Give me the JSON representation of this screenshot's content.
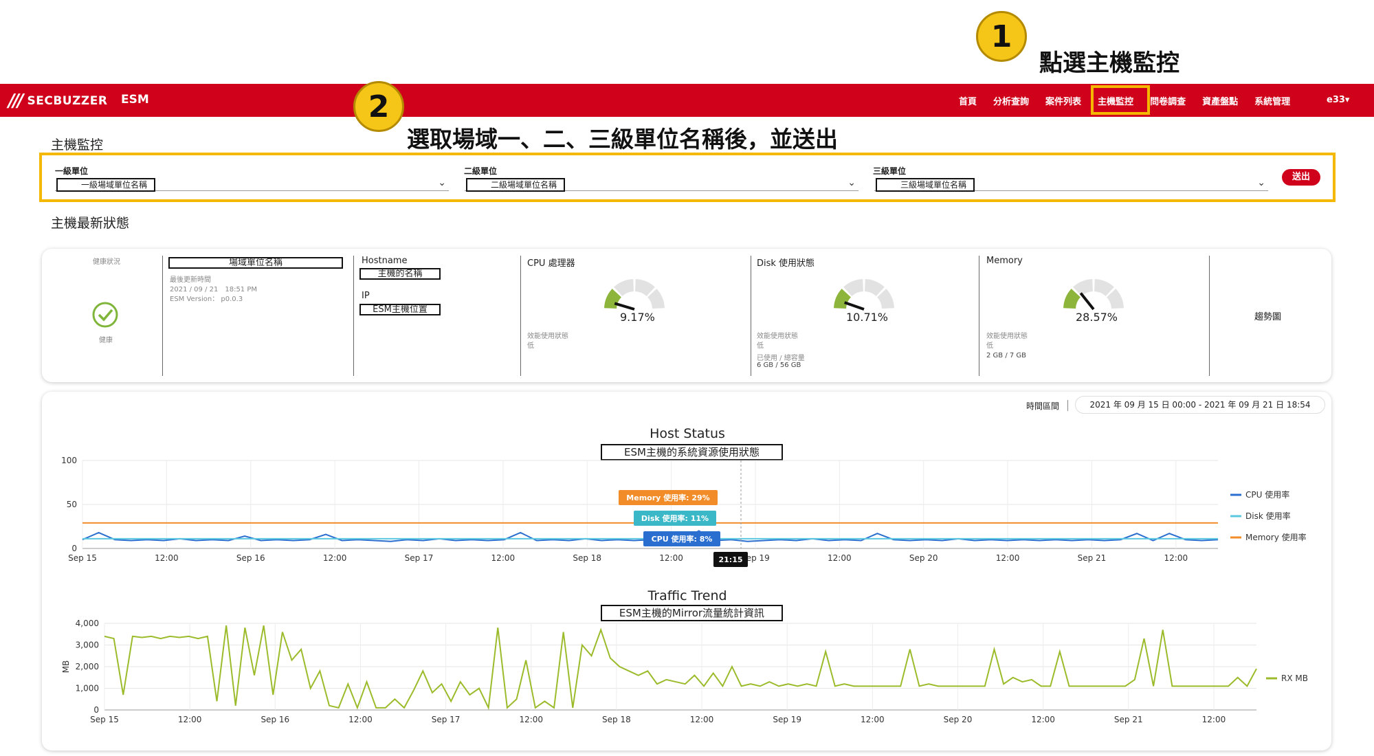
{
  "annotations": {
    "step1": {
      "number": "1",
      "text": "點選主機監控"
    },
    "step2": {
      "number": "2",
      "text": "選取場域一、二、三級單位名稱後，並送出"
    }
  },
  "navbar": {
    "logo_mark": "///",
    "logo_text": "SECBUZZER",
    "app_name": "ESM",
    "items": [
      "首頁",
      "分析查詢",
      "案件列表",
      "主機監控",
      "問卷調查",
      "資產盤點",
      "系統管理"
    ],
    "active_item": "主機監控",
    "user": "e33▾",
    "colors": {
      "brand": "#d0021b",
      "highlight": "#f5b800"
    }
  },
  "page": {
    "title": "主機監控",
    "filters": [
      {
        "label": "一級單位",
        "value": "一級場域單位名稱"
      },
      {
        "label": "二級單位",
        "value": "二級場域單位名稱"
      },
      {
        "label": "三級單位",
        "value": "三級場域單位名稱"
      }
    ],
    "submit_label": "送出",
    "status_title": "主機最新狀態"
  },
  "status_card": {
    "health_label": "健康狀況",
    "health_value": "健康",
    "unit_name": "場域單位名稱",
    "last_update_label": "最後更新時間",
    "last_update_value": "2021 / 09 / 21　18:51 PM",
    "esm_version": "ESM Version： p0.0.3",
    "hostname_label": "Hostname",
    "hostname_value": "主機的名稱",
    "ip_label": "IP",
    "ip_value": "ESM主機位置",
    "cpu": {
      "title": "CPU 處理器",
      "value": "9.17%",
      "level": 0.0917,
      "perf_label": "效能使用狀態",
      "perf_value": "低"
    },
    "disk": {
      "title": "Disk 使用狀態",
      "value": "10.71%",
      "level": 0.1071,
      "perf_label": "效能使用狀態",
      "perf_value": "低",
      "used_label": "已使用 / 總容量",
      "used_value": "6 GB / 56 GB"
    },
    "memory": {
      "title": "Memory",
      "value": "28.57%",
      "level": 0.2857,
      "perf_label": "效能使用狀態",
      "perf_value": "低",
      "used_value": "2 GB / 7 GB"
    },
    "trend_label": "趨勢圖"
  },
  "charts_card": {
    "time_range_label": "時間區間",
    "time_range_value": "2021 年 09 月 15 日 00:00 - 2021 年 09 月 21 日 18:54"
  },
  "chart_data": [
    {
      "type": "line",
      "title": "Host Status",
      "subtitle": "ESM主機的系統資源使用狀態",
      "xlabel": "",
      "ylabel": "",
      "ylim": [
        0,
        100
      ],
      "yticks": [
        "0",
        "50",
        "100"
      ],
      "xticks": [
        "Sep 15",
        "12:00",
        "Sep 16",
        "12:00",
        "Sep 17",
        "12:00",
        "Sep 18",
        "12:00",
        "Sep 19",
        "12:00",
        "Sep 20",
        "12:00",
        "Sep 21",
        "12:00"
      ],
      "legend_position": "right",
      "series": [
        {
          "name": "CPU 使用率",
          "color": "#2a6fd0",
          "values": [
            10,
            18,
            10,
            9,
            10,
            9,
            11,
            9,
            10,
            9,
            14,
            9,
            10,
            9,
            10,
            16,
            9,
            10,
            9,
            8,
            10,
            9,
            11,
            9,
            10,
            9,
            10,
            18,
            9,
            10,
            9,
            11,
            9,
            10,
            9,
            10,
            9,
            10,
            20,
            9,
            10,
            8,
            9,
            10,
            9,
            11,
            9,
            10,
            9,
            17,
            10,
            9,
            10,
            9,
            11,
            9,
            10,
            9,
            10,
            9,
            10,
            9,
            10,
            9,
            10,
            17,
            9,
            17,
            10,
            9,
            10
          ]
        },
        {
          "name": "Disk 使用率",
          "color": "#5bc8e0",
          "values": [
            11,
            11,
            11,
            11,
            11,
            11,
            11,
            11,
            11,
            11,
            11,
            11,
            11,
            11,
            11
          ]
        },
        {
          "name": "Memory 使用率",
          "color": "#f28c28",
          "values": [
            29,
            29,
            29,
            29,
            29,
            29,
            29,
            29,
            29,
            29,
            29,
            29,
            29,
            29,
            29
          ]
        }
      ],
      "tooltip": {
        "time": "21:15",
        "memory": "Memory 使用率: 29%",
        "disk": "Disk 使用率: 11%",
        "cpu": "CPU 使用率: 8%"
      }
    },
    {
      "type": "line",
      "title": "Traffic Trend",
      "subtitle": "ESM主機的Mirror流量統計資訊",
      "xlabel": "",
      "ylabel": "MB",
      "ylim": [
        0,
        4000
      ],
      "yticks": [
        "0",
        "1,000",
        "2,000",
        "3,000",
        "4,000"
      ],
      "xticks": [
        "Sep 15",
        "12:00",
        "Sep 16",
        "12:00",
        "Sep 17",
        "12:00",
        "Sep 18",
        "12:00",
        "Sep 19",
        "12:00",
        "Sep 20",
        "12:00",
        "Sep 21",
        "12:00"
      ],
      "legend_position": "right",
      "series": [
        {
          "name": "RX MB",
          "color": "#9bbb2a",
          "values": [
            3400,
            3300,
            700,
            3400,
            3350,
            3400,
            3300,
            3400,
            3350,
            3400,
            3300,
            3400,
            400,
            3900,
            200,
            3800,
            1600,
            3900,
            700,
            3600,
            2300,
            2800,
            1000,
            1800,
            200,
            100,
            1200,
            100,
            1300,
            100,
            100,
            500,
            100,
            900,
            1800,
            800,
            1200,
            400,
            1300,
            700,
            1000,
            100,
            3800,
            100,
            500,
            2300,
            100,
            400,
            100,
            3600,
            100,
            3000,
            2500,
            3700,
            2400,
            2000,
            1800,
            1600,
            1800,
            1200,
            1400,
            1300,
            1200,
            1600,
            1100,
            1700,
            1100,
            2000,
            1100,
            1200,
            1100,
            1300,
            1100,
            1200,
            1100,
            1200,
            1100,
            2700,
            1100,
            1200,
            1100,
            1100,
            1100,
            1100,
            1100,
            1100,
            2800,
            1100,
            1200,
            1100,
            1100,
            1100,
            1100,
            1100,
            1100,
            2800,
            1200,
            1500,
            1300,
            1400,
            1100,
            1100,
            2700,
            1100,
            1100,
            1100,
            1100,
            1100,
            1100,
            1100,
            1400,
            3300,
            1100,
            3700,
            1100,
            1100,
            1100,
            1100,
            1100,
            1100,
            1100,
            1500,
            1100,
            1900
          ]
        }
      ]
    }
  ]
}
